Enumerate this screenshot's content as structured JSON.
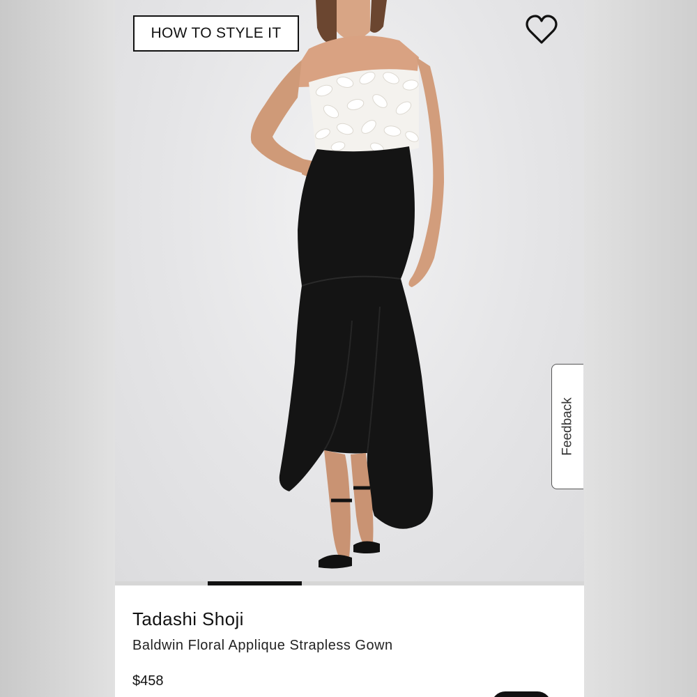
{
  "hero": {
    "style_button_label": "HOW TO STYLE IT",
    "favorite_icon": "heart-outline-icon",
    "feedback_label": "Feedback",
    "image_subject": "model-in-strapless-gown",
    "carousel": {
      "active_index": 2,
      "total": 5
    }
  },
  "product": {
    "brand": "Tadashi Shoji",
    "name": "Baldwin Floral Applique Strapless Gown",
    "price": "$458"
  },
  "colors": {
    "accent": "#111111",
    "background": "#ffffff",
    "hero_backdrop": "#e5e5e7"
  }
}
